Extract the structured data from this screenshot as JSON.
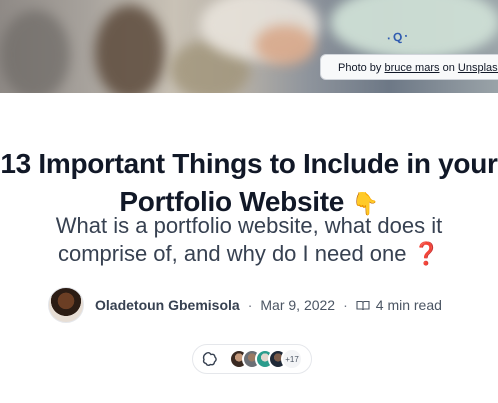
{
  "cover": {
    "photo_credit_prefix": "Photo by",
    "photographer": "bruce mars",
    "credit_middle": "on",
    "source": "Unsplash"
  },
  "article": {
    "title_line1": "13 Important Things to Include in your",
    "title_line2": "Portfolio Website",
    "title_emoji": "👇",
    "subtitle": "What is a portfolio website, what does it comprise of, and why do I need one",
    "subtitle_line1": "What is a portfolio website, what does it",
    "subtitle_line2": "comprise of, and why do I need one",
    "subtitle_emoji": "❓"
  },
  "author": {
    "name": "Oladetoun Gbemisola",
    "date": "Mar 9, 2022",
    "read_time": "4 min read",
    "separator": "·"
  },
  "reactions": {
    "icon": "reaction-icon",
    "more_count": "+17"
  },
  "colors": {
    "title": "#111827",
    "subtitle": "#374151",
    "meta": "#4b5563",
    "accent_question": "#d0312d"
  }
}
